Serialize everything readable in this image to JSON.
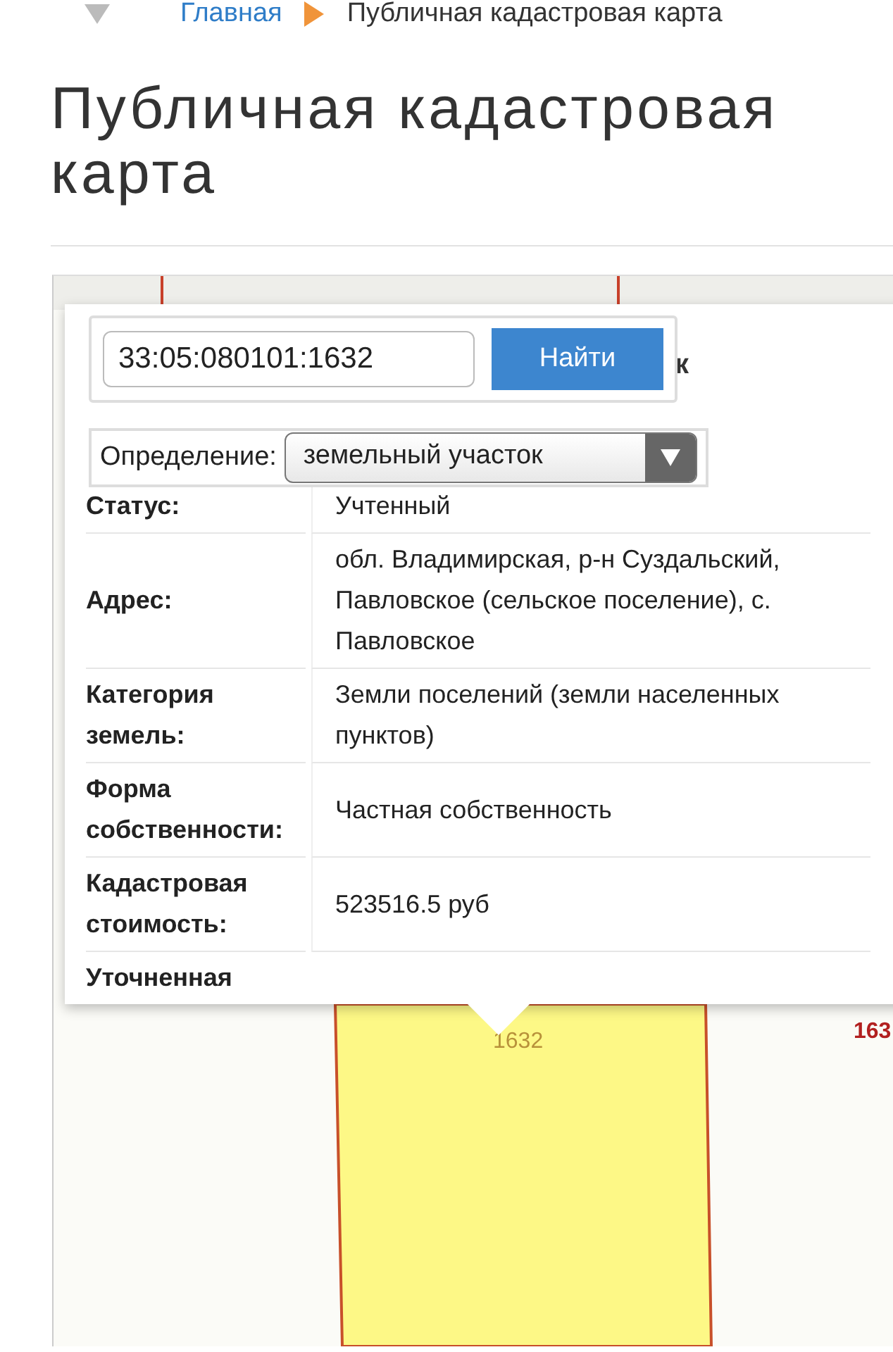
{
  "breadcrumb": [
    {
      "label": "Главная",
      "kind": "link"
    },
    {
      "label": "Публичная кадастровая карта",
      "kind": "current"
    }
  ],
  "page_title": "Публичная кадастровая карта",
  "search": {
    "value": "33:05:080101:1632",
    "button": "Найти"
  },
  "popup_title_fragment": "к",
  "definition": {
    "label": "Определение:",
    "value": "земельный участок"
  },
  "properties": [
    {
      "label": "Статус:",
      "value": "Учтенный"
    },
    {
      "label": "Адрес:",
      "value": "обл. Владимирская, р-н Суздальский, Павловское (сельское поселение), с. Павловское"
    },
    {
      "label": "Категория земель:",
      "value": "Земли поселений (земли населенных пунктов)"
    },
    {
      "label": "Форма собственности:",
      "value": "Частная собственность"
    },
    {
      "label": "Кадастровая стоимость:",
      "value": "523516.5 руб"
    },
    {
      "label": "Уточненная"
    }
  ],
  "map_labels": [
    {
      "text": "1632",
      "kind": "selected"
    },
    {
      "text": "163",
      "kind": "neighbor"
    }
  ]
}
